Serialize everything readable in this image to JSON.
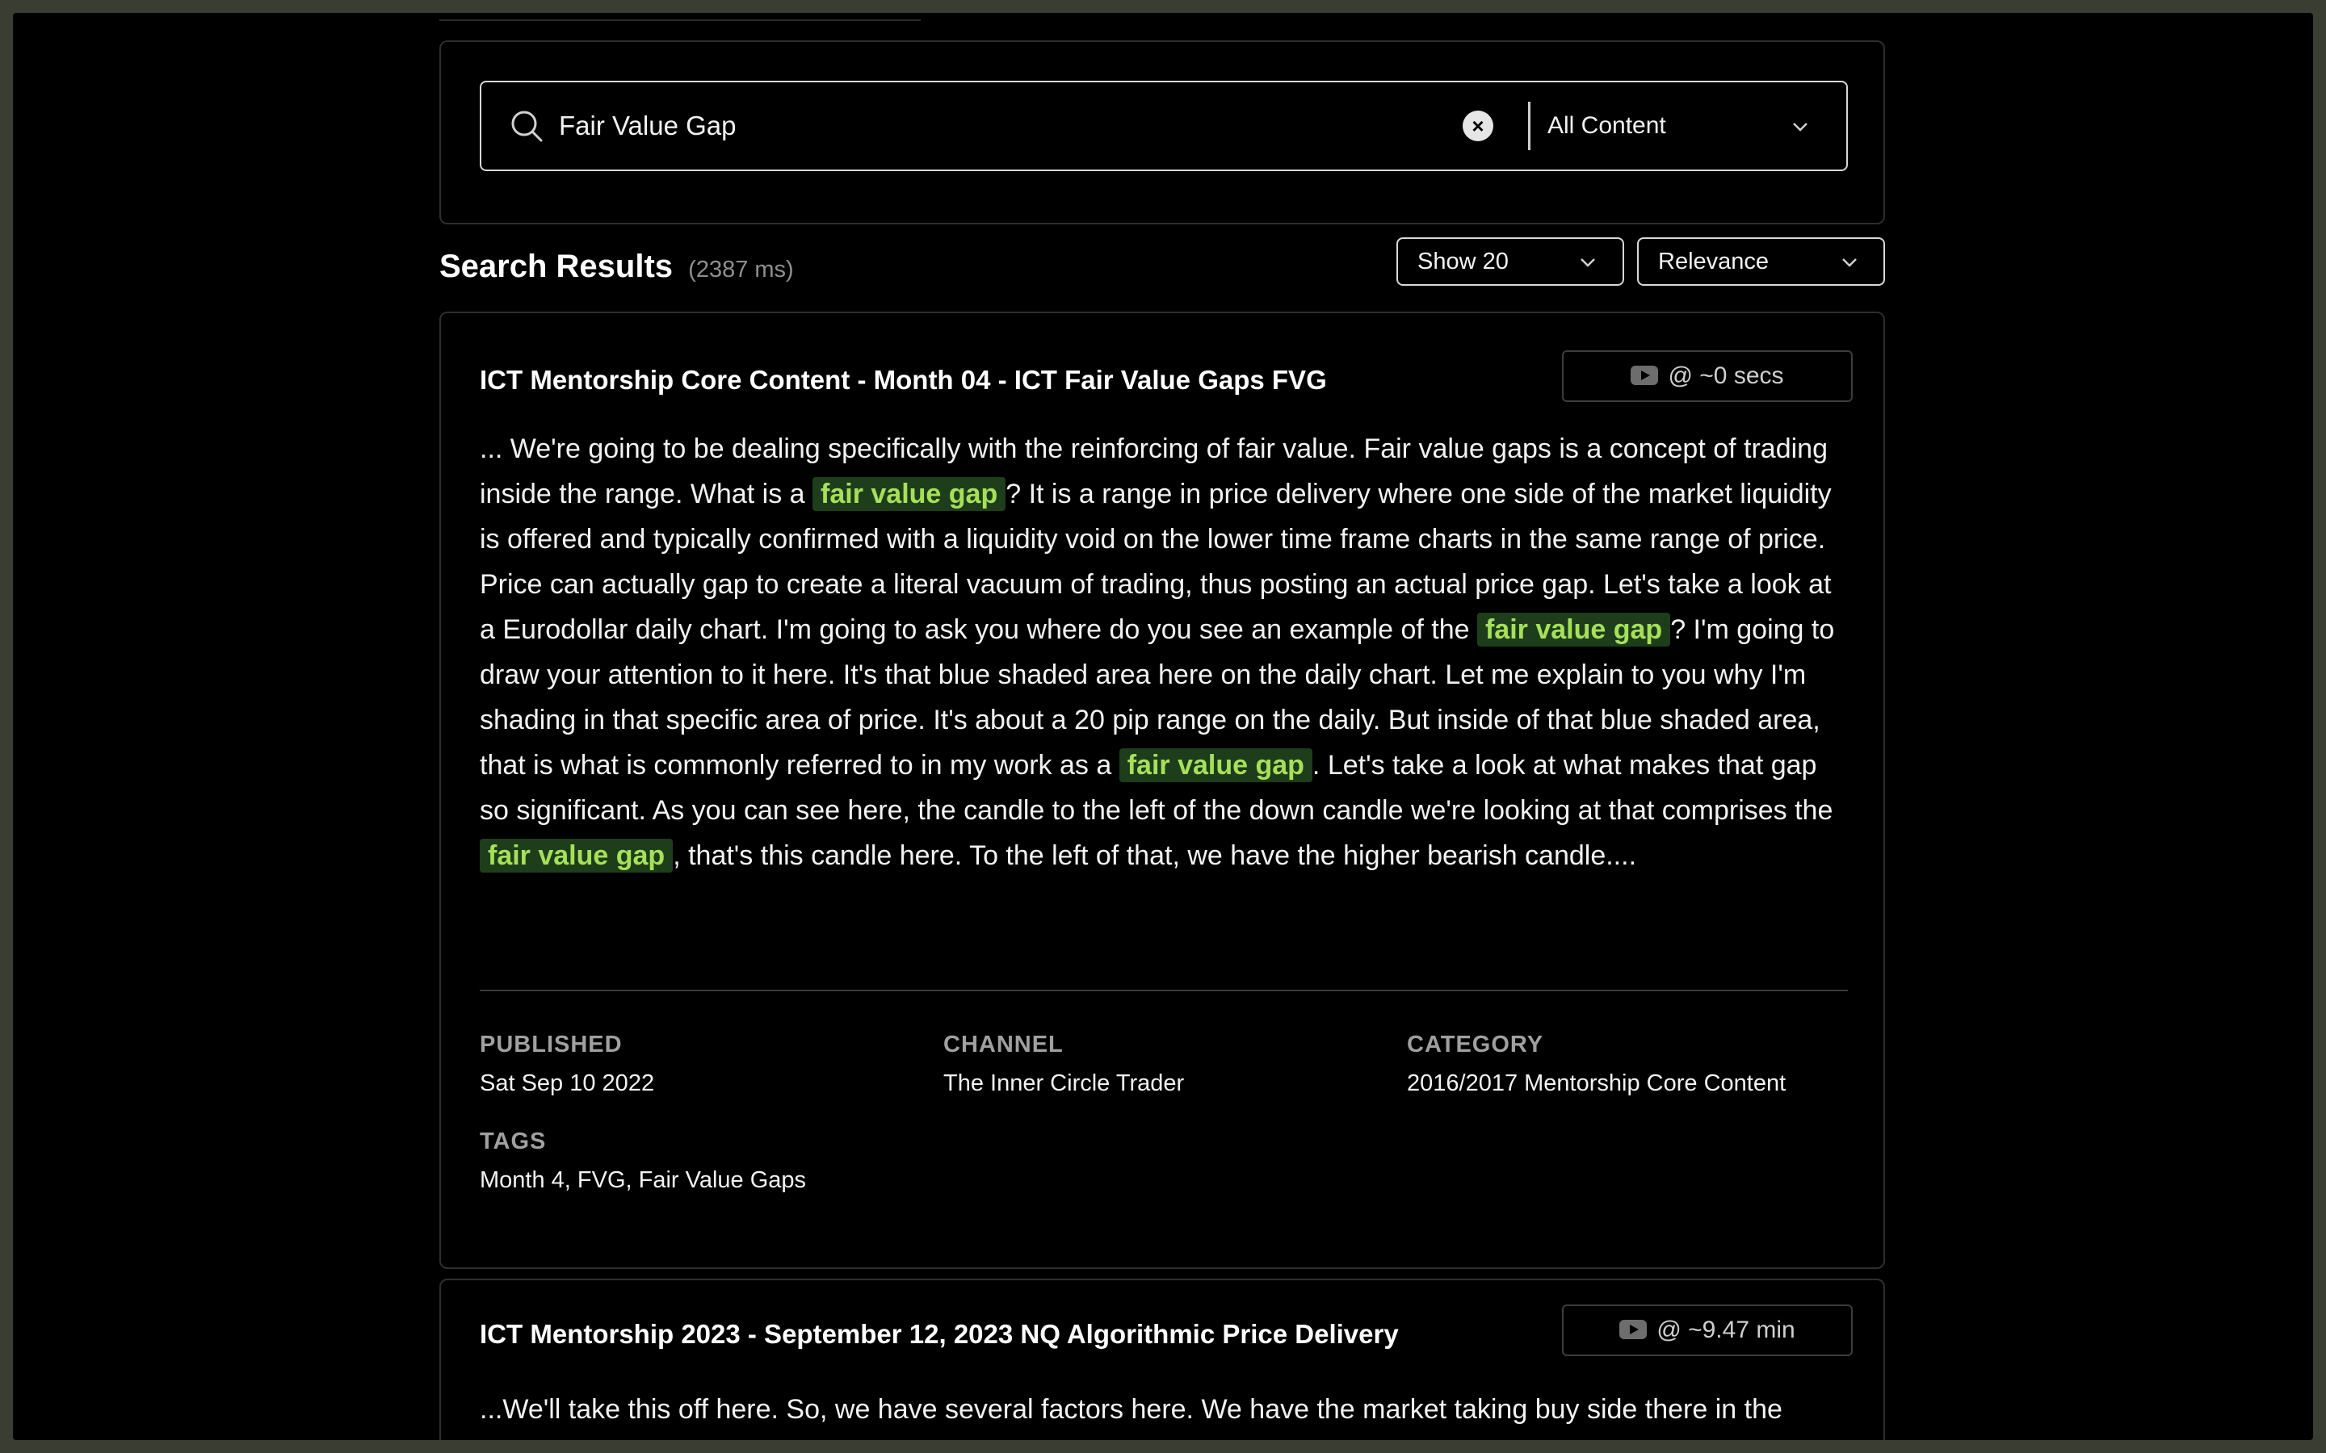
{
  "search": {
    "query": "Fair Value Gap",
    "clear_symbol": "×",
    "scope": "All Content"
  },
  "results_header": {
    "title": "Search Results",
    "timing": "(2387 ms)",
    "show_count": "Show 20",
    "sort": "Relevance"
  },
  "results": [
    {
      "title": "ICT Mentorship Core Content - Month 04 - ICT Fair Value Gaps FVG",
      "timestamp": "@ ~0 secs",
      "snippet": {
        "p1": "... We're going to be dealing specifically with the reinforcing of fair value. Fair value gaps is a concept of trading inside the range. What is a ",
        "hl1": "fair value gap",
        "p2": "? It is a range in price delivery where one side of the market liquidity is offered and typically confirmed with a liquidity void on the lower time frame charts in the same range of price. Price can actually gap to create a literal vacuum of trading, thus posting an actual price gap. Let's take a look at a Eurodollar daily chart. I'm going to ask you where do you see an example of the ",
        "hl2": "fair value gap",
        "p3": "? I'm going to draw your attention to it here. It's that blue shaded area here on the daily chart. Let me explain to you why I'm shading in that specific area of price. It's about a 20 pip range on the daily. But inside of that blue shaded area, that is what is commonly referred to in my work as a ",
        "hl3": "fair value gap",
        "p4": ". Let's take a look at what makes that gap so significant. As you can see here, the candle to the left of the down candle we're looking at that comprises the ",
        "hl4": "fair value gap",
        "p5": ", that's this candle here. To the left of that, we have the higher bearish candle...."
      },
      "meta": {
        "published_label": "PUBLISHED",
        "published": "Sat Sep 10 2022",
        "channel_label": "CHANNEL",
        "channel": "The Inner Circle Trader",
        "category_label": "CATEGORY",
        "category": "2016/2017 Mentorship Core Content",
        "tags_label": "TAGS",
        "tags": "Month 4, FVG, Fair Value Gaps"
      }
    },
    {
      "title": "ICT Mentorship 2023 - September 12, 2023 NQ Algorithmic Price Delivery",
      "timestamp": "@ ~9.47 min",
      "snippet": "...We'll take this off here. So, we have several factors here. We have the market taking buy side there in the"
    }
  ],
  "colors": {
    "highlight_bg": "#1e3d1a",
    "highlight_text": "#a6e05a",
    "background": "#000000",
    "outer_frame": "#3a3d31"
  },
  "icons": {
    "search": "search-icon",
    "clear": "clear-icon",
    "chevron": "chevron-down-icon",
    "video": "youtube-icon"
  }
}
